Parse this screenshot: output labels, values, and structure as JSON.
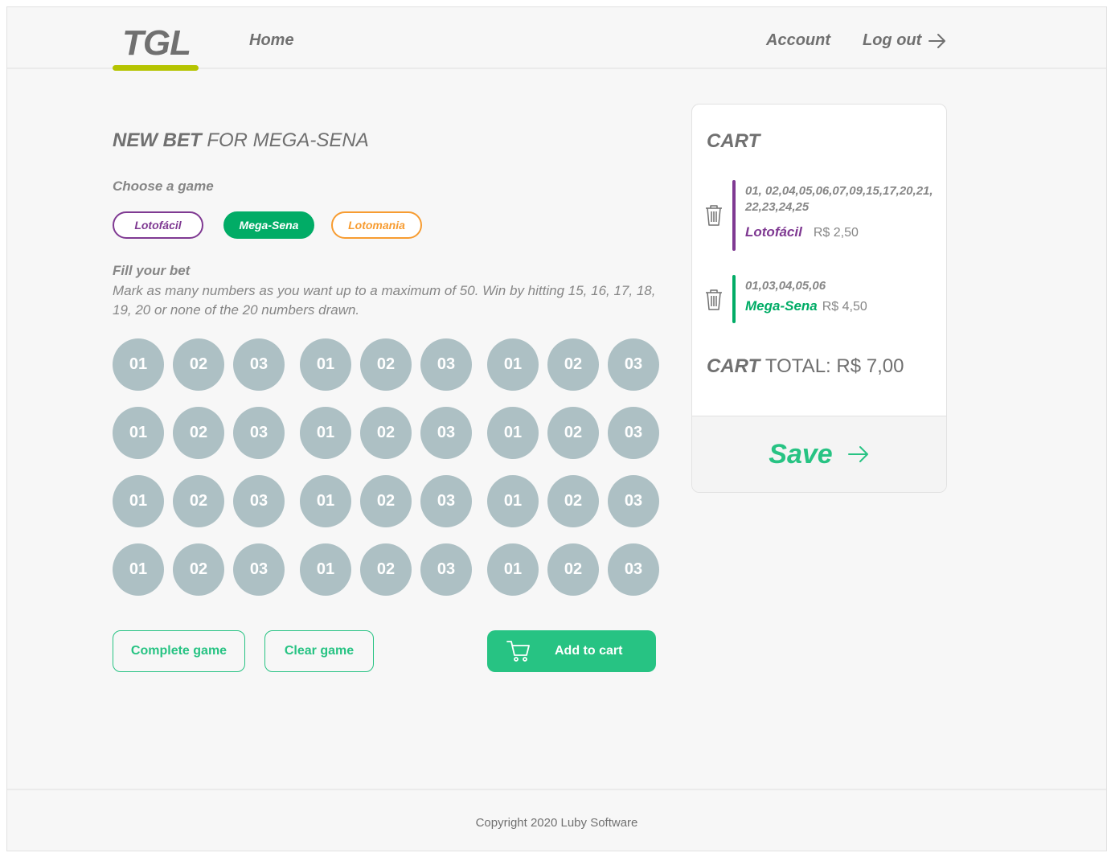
{
  "header": {
    "logo": "TGL",
    "nav_home": "Home",
    "nav_account": "Account",
    "nav_logout": "Log out"
  },
  "bet": {
    "title_bold": "NEW BET",
    "title_light": "FOR MEGA-SENA",
    "choose_label": "Choose a game",
    "games": [
      {
        "label": "Lotofácil",
        "color": "#7f3992",
        "selected": false
      },
      {
        "label": "Mega-Sena",
        "color": "#01ac66",
        "selected": true
      },
      {
        "label": "Lotomania",
        "color": "#f79c31",
        "selected": false
      }
    ],
    "fill_label": "Fill your bet",
    "fill_description": "Mark as many numbers as you want up to a maximum of 50. Win by hitting 15, 16, 17, 18, 19, 20 or none of the 20 numbers drawn.",
    "numbers": [
      [
        "01",
        "02",
        "03",
        "01",
        "02",
        "03",
        "01",
        "02",
        "03"
      ],
      [
        "01",
        "02",
        "03",
        "01",
        "02",
        "03",
        "01",
        "02",
        "03"
      ],
      [
        "01",
        "02",
        "03",
        "01",
        "02",
        "03",
        "01",
        "02",
        "03"
      ],
      [
        "01",
        "02",
        "03",
        "01",
        "02",
        "03",
        "01",
        "02",
        "03"
      ]
    ],
    "complete_label": "Complete game",
    "clear_label": "Clear game",
    "add_label": "Add to cart"
  },
  "cart": {
    "title": "CART",
    "items": [
      {
        "numbers": "01, 02,04,05,06,07,09,15,17,20,21, 22,23,24,25",
        "game": "Lotofácil",
        "price": "R$ 2,50",
        "color": "#7f3992"
      },
      {
        "numbers": "01,03,04,05,06",
        "game": "Mega-Sena",
        "price": "R$ 4,50",
        "color": "#01ac66"
      }
    ],
    "total_bold": "CART",
    "total_rest": "TOTAL: R$ 7,00",
    "save_label": "Save"
  },
  "footer": {
    "copyright": "Copyright 2020  Luby Software"
  },
  "colors": {
    "accent": "#27c383",
    "logo_bar": "#b5c401",
    "number_ball": "#adc0c4"
  },
  "icons": [
    "arrow-right-icon",
    "cart-icon",
    "trash-icon"
  ]
}
